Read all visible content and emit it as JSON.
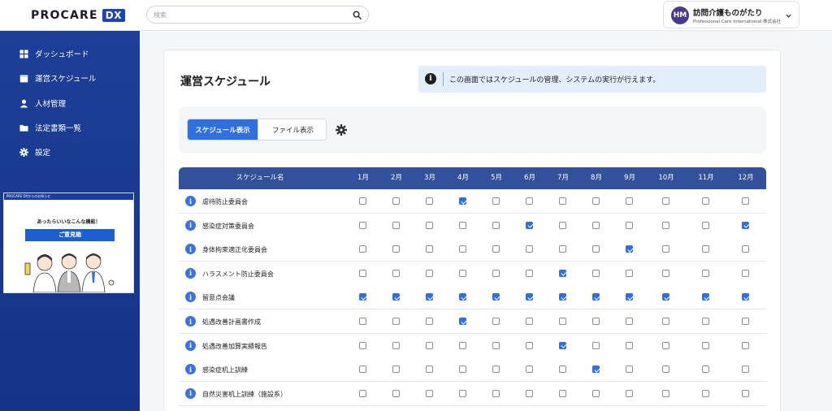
{
  "header": {
    "logo_text": "PROCARE",
    "logo_badge": "DX",
    "search_placeholder": "検索",
    "user": {
      "initials": "HM",
      "name": "訪問介護ものがたり",
      "org": "Professional Care International 株式会社"
    }
  },
  "sidebar": {
    "items": [
      {
        "label": "ダッシュボード",
        "icon": "dashboard-icon"
      },
      {
        "label": "運営スケジュール",
        "icon": "calendar-icon"
      },
      {
        "label": "人材管理",
        "icon": "person-icon"
      },
      {
        "label": "法定書類一覧",
        "icon": "folder-icon"
      },
      {
        "label": "設定",
        "icon": "gear-icon"
      }
    ],
    "banner": {
      "top_text": "PROCARE DXからのお知らせ",
      "headline": "あったらいいなこんな機能！",
      "button": "ご意見箱"
    }
  },
  "main": {
    "title": "運営スケジュール",
    "info_text": "この画面ではスケジュールの管理、システムの実行が行えます。",
    "tabs": [
      {
        "label": "スケジュール表示",
        "active": true
      },
      {
        "label": "ファイル表示",
        "active": false
      }
    ],
    "table": {
      "name_header": "スケジュール名",
      "months": [
        "1月",
        "2月",
        "3月",
        "4月",
        "5月",
        "6月",
        "7月",
        "8月",
        "9月",
        "10月",
        "11月",
        "12月"
      ],
      "rows": [
        {
          "name": "虐待防止委員会",
          "checked": [
            0,
            0,
            0,
            1,
            0,
            0,
            0,
            0,
            0,
            0,
            0,
            0
          ]
        },
        {
          "name": "感染症対策委員会",
          "checked": [
            0,
            0,
            0,
            0,
            0,
            1,
            0,
            0,
            0,
            0,
            0,
            1
          ]
        },
        {
          "name": "身体拘束適正化委員会",
          "checked": [
            0,
            0,
            0,
            0,
            0,
            0,
            0,
            0,
            1,
            0,
            0,
            0
          ]
        },
        {
          "name": "ハラスメント防止委員会",
          "checked": [
            0,
            0,
            0,
            0,
            0,
            0,
            1,
            0,
            0,
            0,
            0,
            0
          ]
        },
        {
          "name": "留意点会議",
          "checked": [
            1,
            1,
            1,
            1,
            1,
            1,
            1,
            1,
            1,
            1,
            1,
            1
          ]
        },
        {
          "name": "処遇改善計画書作成",
          "checked": [
            0,
            0,
            0,
            1,
            0,
            0,
            0,
            0,
            0,
            0,
            0,
            0
          ]
        },
        {
          "name": "処遇改善加算実績報告",
          "checked": [
            0,
            0,
            0,
            0,
            0,
            0,
            1,
            0,
            0,
            0,
            0,
            0
          ]
        },
        {
          "name": "感染症机上訓練",
          "checked": [
            0,
            0,
            0,
            0,
            0,
            0,
            0,
            1,
            0,
            0,
            0,
            0
          ]
        },
        {
          "name": "自然災害机上訓練（施設系）",
          "checked": [
            0,
            0,
            0,
            0,
            0,
            0,
            0,
            0,
            0,
            0,
            0,
            0
          ]
        }
      ]
    }
  },
  "colors": {
    "sidebar_bg": "#1d3f97",
    "accent": "#2f6fe0",
    "table_header": "#33519a",
    "info_bg": "#e3eefb"
  }
}
